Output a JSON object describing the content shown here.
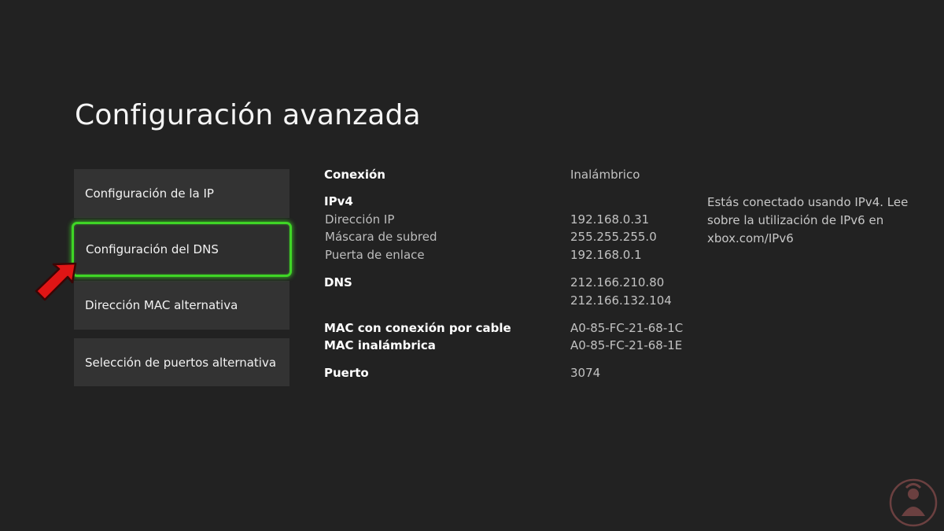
{
  "page": {
    "title": "Configuración avanzada"
  },
  "menu": {
    "items": [
      {
        "label": "Configuración de la IP"
      },
      {
        "label": "Configuración del DNS"
      },
      {
        "label": "Dirección MAC alternativa"
      },
      {
        "label": "Selección de puertos alternativa"
      }
    ],
    "selected_index": 1
  },
  "details": {
    "connection_label": "Conexión",
    "connection_value": "Inalámbrico",
    "ipv4_heading": "IPv4",
    "ip_label": "Dirección IP",
    "ip_value": "192.168.0.31",
    "mask_label": "Máscara de subred",
    "mask_value": "255.255.255.0",
    "gateway_label": "Puerta de enlace",
    "gateway_value": "192.168.0.1",
    "dns_label": "DNS",
    "dns_primary": "212.166.210.80",
    "dns_secondary": "212.166.132.104",
    "mac_wired_label": "MAC con conexión por cable",
    "mac_wired_value": "A0-85-FC-21-68-1C",
    "mac_wireless_label": "MAC inalámbrica",
    "mac_wireless_value": "A0-85-FC-21-68-1E",
    "port_label": "Puerto",
    "port_value": "3074"
  },
  "info": {
    "line1": "Estás conectado usando IPv4. Lee",
    "line2": "sobre la utilización de IPv6 en",
    "line3": "xbox.com/IPv6"
  },
  "colors": {
    "background": "#222222",
    "menu_item": "#333333",
    "focus_border": "#3fd526",
    "arrow": "#e01515"
  },
  "icons": {
    "pointer": "red-arrow-icon",
    "watermark": "watermark-logo-icon"
  }
}
